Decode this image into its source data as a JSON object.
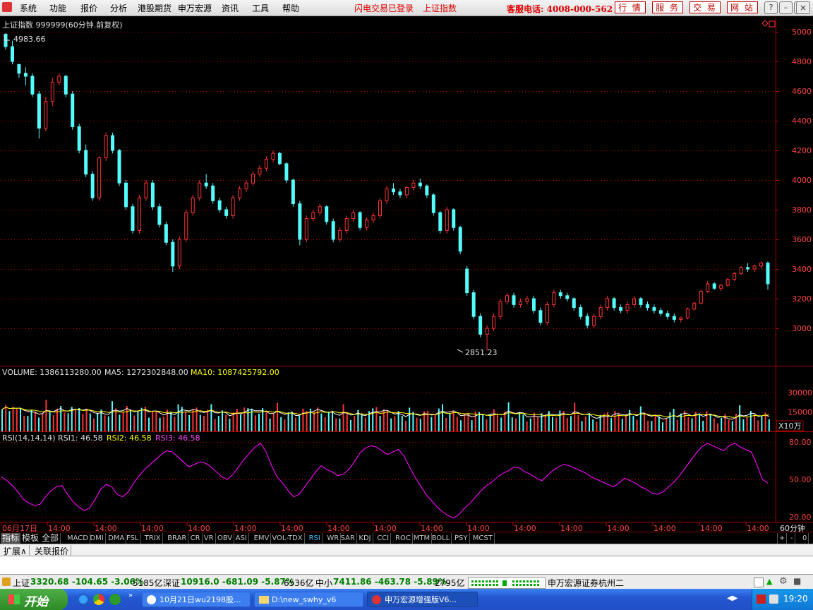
{
  "menu": {
    "items": [
      "系统",
      "功能",
      "报价",
      "分析",
      "港股期货",
      "申万宏源",
      "资讯",
      "工具",
      "帮助"
    ],
    "status1": "闪电交易已登录",
    "status2": "上证指数",
    "hotline": "客服电话: 4008-000-562",
    "buttons": [
      "行 情",
      "服 务",
      "交 易",
      "网 站"
    ]
  },
  "chart_header": {
    "title": "上证指数 999999(60分钟.前复权)",
    "high_label": "4983.66",
    "low_label": "2851.23"
  },
  "volume_header": {
    "volume": "VOLUME: 1386113280.00",
    "ma5": "MA5: 1272302848.00",
    "ma10": "MA10: 1087425792.00",
    "unit": "X10万"
  },
  "rsi_header": {
    "name": "RSI(14,14,14)",
    "rsi1": "RSI1: 46.58",
    "rsi2": "RSI2: 46.58",
    "rsi3": "RSI3: 46.58"
  },
  "price_axis": [
    "5000",
    "4800",
    "4600",
    "4400",
    "4200",
    "4000",
    "3800",
    "3600",
    "3400",
    "3200",
    "3000"
  ],
  "volume_axis": [
    "30000",
    "15000"
  ],
  "rsi_axis": [
    "80.00",
    "50.00",
    "20.00"
  ],
  "time_axis": [
    "06月17日",
    "14:00",
    "14:00",
    "14:00",
    "14:00",
    "14:00",
    "14:00",
    "14:00",
    "14:00",
    "14:00",
    "14:00",
    "14:00",
    "14:00",
    "14:00",
    "14:00",
    "14:00",
    "14:00"
  ],
  "period_label": "60分钟",
  "indicator_bar": {
    "tabs": [
      "指标",
      "模板",
      "全部"
    ],
    "items": [
      "MACD",
      "DMI",
      "DMA",
      "FSL",
      "TRIX",
      "BRAR",
      "CR",
      "VR",
      "OBV",
      "ASI",
      "EMV",
      "VOL-TDX",
      "RSI",
      "WR",
      "SAR",
      "KDJ",
      "CCI",
      "ROC",
      "MTM",
      "BOLL",
      "PSY",
      "MCST"
    ],
    "active": "RSI",
    "right_controls": [
      "+",
      "-",
      "0"
    ]
  },
  "ext_bar": [
    "扩展∧",
    "关联报价"
  ],
  "status_bar": {
    "sh_label": "上证",
    "sh_value": "3320.68 -104.65 -3.06%",
    "sh_amount": "5185亿",
    "sz_label": "深证",
    "sz_value": "10916.0 -681.09 -5.87%",
    "sz_amount": "6536亿",
    "zx_label": "中小",
    "zx_value": "7411.86 -463.78 -5.89%",
    "zx_amount": "2795亿",
    "broker": "申万宏源证券杭州二"
  },
  "taskbar": {
    "start": "开始",
    "tasks": [
      "10月21日wu2198股...",
      "D:\\new_swhy_v6",
      "申万宏源增强版V6..."
    ],
    "clock": "19:20"
  },
  "colors": {
    "up": "#ff3333",
    "down": "#54fcfc",
    "ma5": "#ffffff",
    "ma10": "#ffff00",
    "rsi": "#ff00ff",
    "grid": "#b00000"
  },
  "chart_data": {
    "type": "candlestick",
    "interval": "60分钟",
    "ylim": [
      2800,
      5050
    ],
    "ohlc": [
      [
        4983.66,
        4990,
        4880,
        4900
      ],
      [
        4900,
        4940,
        4780,
        4800
      ],
      [
        4780,
        4780,
        4690,
        4720
      ],
      [
        4720,
        4760,
        4640,
        4700
      ],
      [
        4700,
        4720,
        4560,
        4580
      ],
      [
        4580,
        4600,
        4280,
        4350
      ],
      [
        4350,
        4560,
        4330,
        4530
      ],
      [
        4530,
        4690,
        4500,
        4660
      ],
      [
        4660,
        4720,
        4640,
        4700
      ],
      [
        4700,
        4710,
        4560,
        4580
      ],
      [
        4580,
        4600,
        4340,
        4360
      ],
      [
        4360,
        4380,
        4180,
        4200
      ],
      [
        4200,
        4240,
        4020,
        4040
      ],
      [
        4040,
        4060,
        3860,
        3880
      ],
      [
        3880,
        4160,
        3860,
        4150
      ],
      [
        4150,
        4320,
        4130,
        4300
      ],
      [
        4300,
        4320,
        4180,
        4200
      ],
      [
        4200,
        4210,
        3960,
        3980
      ],
      [
        3980,
        4000,
        3800,
        3820
      ],
      [
        3820,
        3840,
        3640,
        3660
      ],
      [
        3660,
        3900,
        3640,
        3880
      ],
      [
        3880,
        4000,
        3860,
        3980
      ],
      [
        3980,
        4000,
        3800,
        3820
      ],
      [
        3820,
        3840,
        3680,
        3700
      ],
      [
        3700,
        3720,
        3560,
        3580
      ],
      [
        3580,
        3600,
        3380,
        3420
      ],
      [
        3420,
        3620,
        3400,
        3600
      ],
      [
        3600,
        3800,
        3580,
        3780
      ],
      [
        3780,
        3900,
        3760,
        3880
      ],
      [
        3880,
        4000,
        3860,
        3980
      ],
      [
        3980,
        4040,
        3940,
        3960
      ],
      [
        3960,
        3980,
        3840,
        3860
      ],
      [
        3860,
        3880,
        3780,
        3800
      ],
      [
        3800,
        3820,
        3740,
        3760
      ],
      [
        3760,
        3900,
        3740,
        3880
      ],
      [
        3880,
        3960,
        3860,
        3940
      ],
      [
        3940,
        4000,
        3920,
        3980
      ],
      [
        3980,
        4060,
        3960,
        4040
      ],
      [
        4040,
        4100,
        4020,
        4080
      ],
      [
        4080,
        4160,
        4060,
        4140
      ],
      [
        4140,
        4200,
        4120,
        4180
      ],
      [
        4180,
        4190,
        4100,
        4110
      ],
      [
        4110,
        4120,
        3980,
        4000
      ],
      [
        4000,
        4010,
        3820,
        3840
      ],
      [
        3840,
        3860,
        3560,
        3600
      ],
      [
        3600,
        3760,
        3580,
        3740
      ],
      [
        3740,
        3800,
        3720,
        3780
      ],
      [
        3780,
        3840,
        3760,
        3820
      ],
      [
        3820,
        3830,
        3700,
        3720
      ],
      [
        3720,
        3740,
        3580,
        3600
      ],
      [
        3600,
        3680,
        3580,
        3660
      ],
      [
        3660,
        3760,
        3640,
        3740
      ],
      [
        3740,
        3800,
        3720,
        3780
      ],
      [
        3780,
        3790,
        3660,
        3680
      ],
      [
        3680,
        3750,
        3660,
        3730
      ],
      [
        3730,
        3780,
        3710,
        3760
      ],
      [
        3760,
        3880,
        3740,
        3860
      ],
      [
        3860,
        3960,
        3840,
        3940
      ],
      [
        3940,
        3980,
        3900,
        3920
      ],
      [
        3920,
        3940,
        3880,
        3900
      ],
      [
        3900,
        3960,
        3880,
        3950
      ],
      [
        3950,
        4000,
        3930,
        3980
      ],
      [
        3980,
        4010,
        3940,
        3960
      ],
      [
        3960,
        3970,
        3880,
        3900
      ],
      [
        3900,
        3910,
        3760,
        3780
      ],
      [
        3780,
        3790,
        3640,
        3660
      ],
      [
        3660,
        3820,
        3640,
        3800
      ],
      [
        3800,
        3810,
        3660,
        3680
      ],
      [
        3680,
        3690,
        3500,
        3520
      ],
      [
        3400,
        3420,
        3220,
        3240
      ],
      [
        3240,
        3260,
        3060,
        3080
      ],
      [
        3080,
        3100,
        2940,
        2960
      ],
      [
        2960,
        3020,
        2851.23,
        3000
      ],
      [
        3000,
        3100,
        2980,
        3080
      ],
      [
        3080,
        3200,
        3060,
        3180
      ],
      [
        3180,
        3240,
        3160,
        3220
      ],
      [
        3220,
        3240,
        3140,
        3160
      ],
      [
        3160,
        3200,
        3140,
        3180
      ],
      [
        3180,
        3220,
        3160,
        3200
      ],
      [
        3200,
        3220,
        3100,
        3120
      ],
      [
        3120,
        3140,
        3020,
        3040
      ],
      [
        3040,
        3180,
        3020,
        3160
      ],
      [
        3160,
        3260,
        3140,
        3240
      ],
      [
        3240,
        3260,
        3200,
        3220
      ],
      [
        3220,
        3240,
        3180,
        3200
      ],
      [
        3200,
        3210,
        3120,
        3140
      ],
      [
        3140,
        3160,
        3060,
        3080
      ],
      [
        3080,
        3100,
        3000,
        3020
      ],
      [
        3020,
        3100,
        3000,
        3080
      ],
      [
        3080,
        3160,
        3060,
        3140
      ],
      [
        3140,
        3220,
        3120,
        3200
      ],
      [
        3200,
        3210,
        3120,
        3140
      ],
      [
        3140,
        3160,
        3100,
        3120
      ],
      [
        3120,
        3180,
        3100,
        3160
      ],
      [
        3160,
        3220,
        3140,
        3200
      ],
      [
        3200,
        3210,
        3140,
        3160
      ],
      [
        3160,
        3180,
        3120,
        3140
      ],
      [
        3140,
        3160,
        3100,
        3120
      ],
      [
        3120,
        3140,
        3080,
        3100
      ],
      [
        3100,
        3120,
        3060,
        3080
      ],
      [
        3080,
        3100,
        3040,
        3060
      ],
      [
        3060,
        3080,
        3040,
        3070
      ],
      [
        3070,
        3140,
        3060,
        3130
      ],
      [
        3130,
        3180,
        3120,
        3170
      ],
      [
        3170,
        3260,
        3160,
        3250
      ],
      [
        3250,
        3320,
        3240,
        3300
      ],
      [
        3300,
        3310,
        3260,
        3270
      ],
      [
        3270,
        3300,
        3250,
        3290
      ],
      [
        3290,
        3340,
        3280,
        3330
      ],
      [
        3330,
        3380,
        3320,
        3370
      ],
      [
        3370,
        3420,
        3360,
        3410
      ],
      [
        3410,
        3440,
        3380,
        3400
      ],
      [
        3400,
        3430,
        3380,
        3420
      ],
      [
        3420,
        3450,
        3400,
        3440
      ],
      [
        3440,
        3450,
        3260,
        3300
      ]
    ],
    "volume_axis": [
      15000,
      30000
    ],
    "rsi": [
      52,
      49,
      45,
      40,
      34,
      31,
      29,
      30,
      36,
      41,
      44,
      45,
      38,
      32,
      28,
      25,
      27,
      34,
      42,
      46,
      44,
      38,
      36,
      40,
      47,
      53,
      58,
      62,
      66,
      70,
      73,
      72,
      68,
      64,
      60,
      62,
      64,
      63,
      60,
      56,
      52,
      50,
      54,
      60,
      66,
      71,
      76,
      79,
      72,
      61,
      52,
      47,
      41,
      36,
      38,
      44,
      50,
      56,
      61,
      58,
      56,
      53,
      54,
      58,
      64,
      71,
      75,
      77,
      76,
      73,
      70,
      72,
      74,
      69,
      60,
      52,
      45,
      38,
      33,
      28,
      24,
      21,
      19,
      22,
      27,
      31,
      36,
      41,
      45,
      48,
      52,
      55,
      57,
      60,
      59,
      56,
      54,
      51,
      49,
      53,
      57,
      60,
      62,
      61,
      59,
      57,
      55,
      52,
      50,
      48,
      46,
      44,
      47,
      51,
      49,
      47,
      44,
      42,
      39,
      38,
      40,
      44,
      48,
      53,
      59,
      65,
      71,
      76,
      79,
      77,
      75,
      73,
      77,
      79,
      76,
      74,
      72,
      62,
      50,
      47
    ]
  }
}
